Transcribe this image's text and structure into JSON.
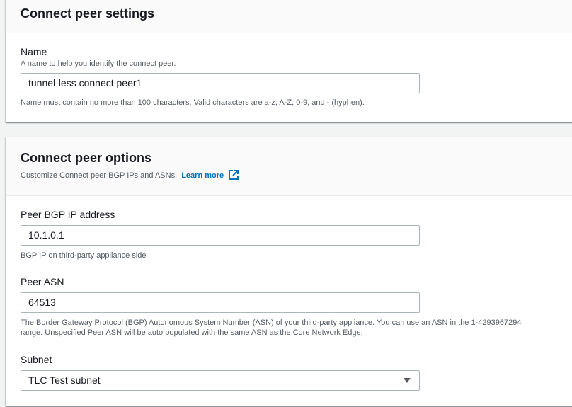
{
  "settings": {
    "title": "Connect peer settings",
    "name_label": "Name",
    "name_desc": "A name to help you identify the connect peer.",
    "name_value": "tunnel-less connect peer1",
    "name_constraint": "Name must contain no more than 100 characters. Valid characters are a-z, A-Z, 0-9, and - (hyphen)."
  },
  "options": {
    "title": "Connect peer options",
    "desc": "Customize Connect peer BGP IPs and ASNs.",
    "learn_more": "Learn more",
    "bgp_label": "Peer BGP IP address",
    "bgp_value": "10.1.0.1",
    "bgp_hint": "BGP IP on third-party appliance side",
    "asn_label": "Peer ASN",
    "asn_value": "64513",
    "asn_hint": "The Border Gateway Protocol (BGP) Autonomous System Number (ASN) of your third-party appliance. You can use an ASN in the 1-4293967294 range. Unspecified Peer ASN will be auto populated with the same ASN as the Core Network Edge.",
    "subnet_label": "Subnet",
    "subnet_value": "TLC Test subnet"
  }
}
